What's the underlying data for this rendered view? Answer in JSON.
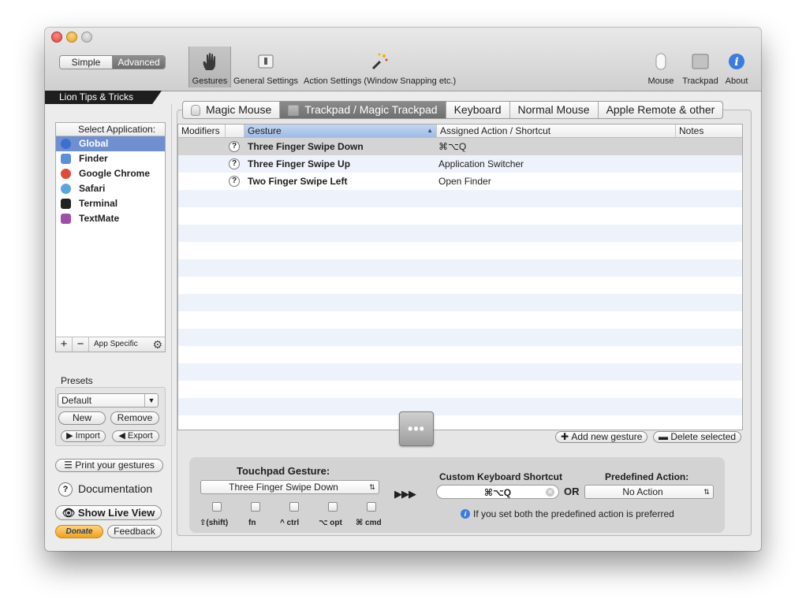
{
  "mode_switch": {
    "simple": "Simple",
    "advanced": "Advanced"
  },
  "toolbar": {
    "gestures": "Gestures",
    "general_settings": "General Settings",
    "action_settings": "Action Settings (Window Snapping etc.)",
    "mouse": "Mouse",
    "trackpad": "Trackpad",
    "about": "About"
  },
  "ribbon": "Lion Tips & Tricks",
  "apps": {
    "header": "Select Application:",
    "items": [
      {
        "name": "Global",
        "icon": "globe-icon",
        "color": "#3b6fd1"
      },
      {
        "name": "Finder",
        "icon": "finder-icon",
        "color": "#5b8fd8"
      },
      {
        "name": "Google Chrome",
        "icon": "chrome-icon",
        "color": "#e04a3a"
      },
      {
        "name": "Safari",
        "icon": "safari-icon",
        "color": "#5aa7e0"
      },
      {
        "name": "Terminal",
        "icon": "terminal-icon",
        "color": "#222222"
      },
      {
        "name": "TextMate",
        "icon": "textmate-icon",
        "color": "#a04fa8"
      }
    ],
    "add": "+",
    "remove": "−",
    "app_specific": "App Specific"
  },
  "presets": {
    "label": "Presets",
    "selected": "Default",
    "new": "New",
    "remove": "Remove",
    "import": "Import",
    "export": "Export"
  },
  "sidebar_bottom": {
    "print": "Print your gestures",
    "documentation": "Documentation",
    "live_view": "Show Live View",
    "donate": "Donate",
    "feedback": "Feedback"
  },
  "tabs": [
    {
      "label": "Magic Mouse",
      "icon": "magic-mouse-icon"
    },
    {
      "label": "Trackpad / Magic Trackpad",
      "icon": "trackpad-icon"
    },
    {
      "label": "Keyboard"
    },
    {
      "label": "Normal Mouse"
    },
    {
      "label": "Apple Remote & other"
    }
  ],
  "table": {
    "columns": {
      "modifiers": "Modifiers",
      "gesture": "Gesture",
      "action": "Assigned Action / Shortcut",
      "notes": "Notes"
    },
    "rows": [
      {
        "gesture": "Three Finger Swipe Down",
        "action": "⌘⌥Q"
      },
      {
        "gesture": "Three Finger Swipe Up",
        "action": "Application Switcher"
      },
      {
        "gesture": "Two Finger Swipe Left",
        "action": "Open Finder"
      }
    ],
    "help": "?"
  },
  "actions": {
    "add": "Add new gesture",
    "delete": "Delete selected"
  },
  "editor": {
    "gesture_title": "Touchpad Gesture:",
    "gesture_value": "Three Finger Swipe Down",
    "modifiers": [
      "⇧(shift)",
      "fn",
      "^ ctrl",
      "⌥ opt",
      "⌘ cmd"
    ],
    "arrows": "▶▶▶",
    "shortcut_title": "Custom Keyboard Shortcut",
    "shortcut_value": "⌘⌥Q",
    "or": "OR",
    "predefined_title": "Predefined Action:",
    "predefined_value": "No Action",
    "note": "If you set both the predefined action is preferred"
  },
  "colors": {
    "selection": "#6f8fd0",
    "sorted_header": "#aec6ec",
    "donate": "#f0a11c"
  }
}
